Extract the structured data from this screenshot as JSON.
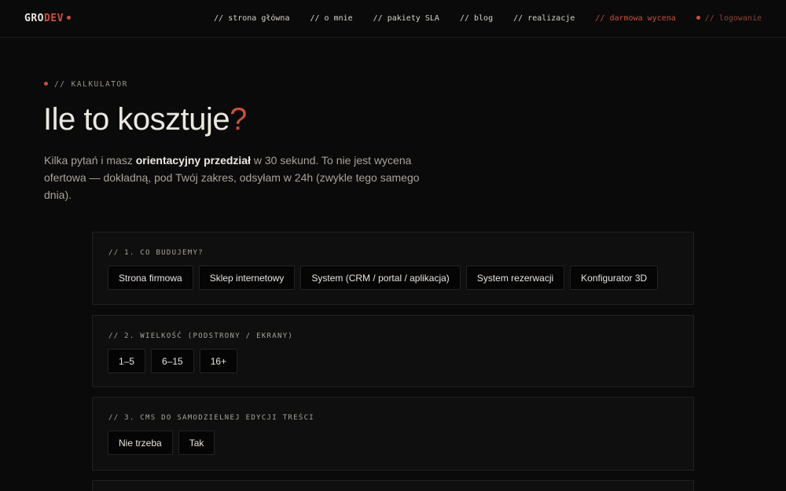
{
  "header": {
    "logo_prefix": "GRO",
    "logo_suffix": "DEV",
    "nav": [
      "// strona główna",
      "// o mnie",
      "// pakiety SLA",
      "// blog",
      "// realizacje",
      "// darmowa wycena",
      "// logowanie"
    ]
  },
  "hero": {
    "eyebrow": "// KALKULATOR",
    "title": "Ile to kosztuje",
    "title_mark": "?",
    "lead_1": "Kilka pytań i masz ",
    "lead_bold": "orientacyjny przedział",
    "lead_2": " w 30 sekund. To nie jest wycena ofertowa — dokładną, pod Twój zakres, odsyłam w 24h (zwykle tego samego dnia)."
  },
  "questions": [
    {
      "label": "// 1. CO BUDUJEMY?",
      "options": [
        "Strona firmowa",
        "Sklep internetowy",
        "System (CRM / portal / aplikacja)",
        "System rezerwacji",
        "Konfigurator 3D"
      ]
    },
    {
      "label": "// 2. WIELKOŚĆ (PODSTRONY / EKRANY)",
      "options": [
        "1–5",
        "6–15",
        "16+"
      ]
    },
    {
      "label": "// 3. CMS DO SAMODZIELNEJ EDYCJI TREŚCI",
      "options": [
        "Nie trzeba",
        "Tak"
      ]
    }
  ],
  "colors": {
    "accent": "#c8503f",
    "background": "#0a0a0a",
    "card": "#0f0f0f"
  }
}
